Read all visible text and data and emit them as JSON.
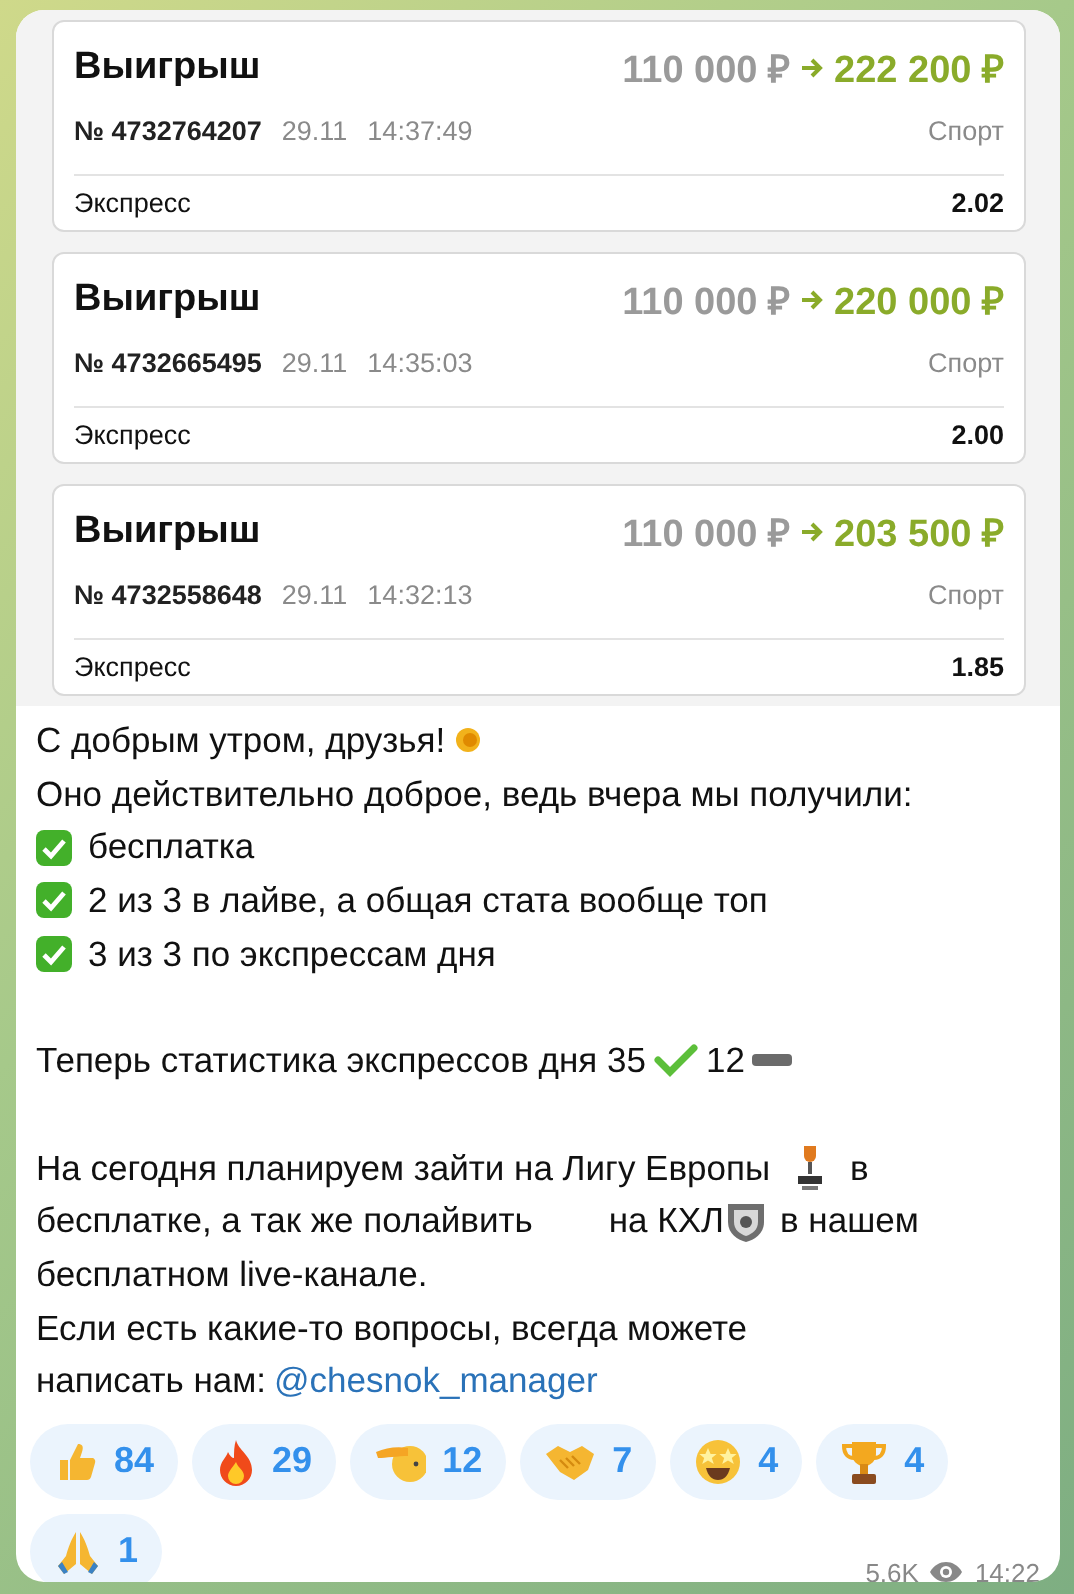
{
  "bets": [
    {
      "title": "Выигрыш",
      "stake": "110 000 ₽",
      "payout": "222 200 ₽",
      "number": "№ 4732764207",
      "date": "29.11",
      "time": "14:37:49",
      "category": "Спорт",
      "type": "Экспресс",
      "odds": "2.02"
    },
    {
      "title": "Выигрыш",
      "stake": "110 000 ₽",
      "payout": "220 000 ₽",
      "number": "№ 4732665495",
      "date": "29.11",
      "time": "14:35:03",
      "category": "Спорт",
      "type": "Экспресс",
      "odds": "2.00"
    },
    {
      "title": "Выигрыш",
      "stake": "110 000 ₽",
      "payout": "203 500 ₽",
      "number": "№ 4732558648",
      "date": "29.11",
      "time": "14:32:13",
      "category": "Спорт",
      "type": "Экспресс",
      "odds": "1.85"
    }
  ],
  "message": {
    "greeting": "С добрым утром, друзья!",
    "intro": "Оно действительно доброе, ведь вчера мы получили:",
    "checklist": [
      "бесплатка",
      "2 из 3 в лайве, а общая стата вообще топ",
      "3 из 3 по экспрессам дня"
    ],
    "stats": {
      "label": "Теперь статистика экспрессов дня 35",
      "losses": "12"
    },
    "plans": [
      "На сегодня планируем зайти на Лигу Европы",
      "в",
      "бесплатке, а так же полайвить",
      "на КХЛ",
      "в нашем",
      "бесплатном live-канале."
    ],
    "contact": [
      "Если есть какие-то вопросы, всегда можете",
      "написать нам:"
    ],
    "link": "@chesnok_manager"
  },
  "reactions": [
    {
      "count": "84"
    },
    {
      "count": "29"
    },
    {
      "count": "12"
    },
    {
      "count": "7"
    },
    {
      "count": "4"
    },
    {
      "count": "4"
    },
    {
      "count": "1"
    }
  ],
  "views": "5.6K",
  "time": "14:22"
}
